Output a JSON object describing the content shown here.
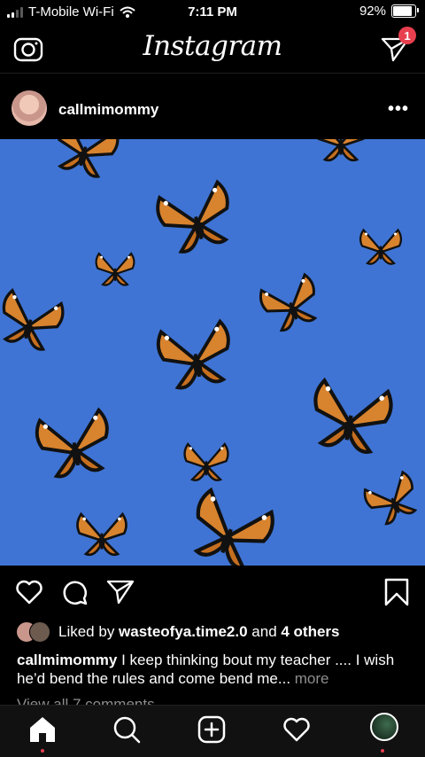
{
  "status_bar": {
    "carrier": "T-Mobile Wi-Fi",
    "time": "7:11 PM",
    "battery": "92%"
  },
  "header": {
    "brand": "Instagram",
    "dm_badge": "1"
  },
  "post": {
    "username": "callmimommy",
    "more_label": "•••",
    "likes": {
      "prefix": "Liked by ",
      "user": "wasteofya.time2.0",
      "middle": " and ",
      "others": "4 others"
    },
    "caption": {
      "username": "callmimommy",
      "text": " I keep thinking bout my teacher .... I wish he’d bend the rules and come bend me...",
      "more": " more"
    },
    "view_comments": "View all 7 comments"
  },
  "icons": {
    "camera": "camera-icon",
    "direct": "direct-message-icon",
    "like": "heart-icon",
    "comment": "comment-icon",
    "share": "share-icon",
    "save": "bookmark-icon",
    "home": "home-icon",
    "search": "search-icon",
    "new_post": "add-post-icon",
    "activity": "activity-heart-icon",
    "profile": "profile-avatar"
  },
  "colors": {
    "background": "#000000",
    "accent_red": "#e83f4f",
    "image_sky": "#3f74d4",
    "muted_text": "#8e8e8e"
  }
}
